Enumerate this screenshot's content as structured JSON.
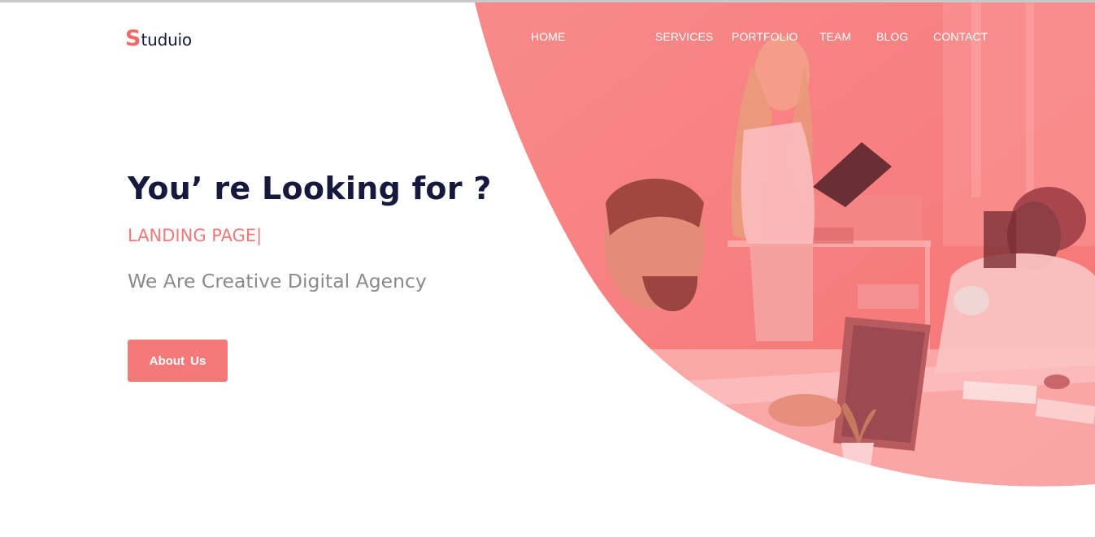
{
  "brand": {
    "logo_initial": "S",
    "logo_rest": "tuduio"
  },
  "nav": {
    "items": [
      {
        "label": "HOME"
      },
      {
        "label": "SERVICES"
      },
      {
        "label": "PORTFOLIO"
      },
      {
        "label": "TEAM"
      },
      {
        "label": "BLOG"
      },
      {
        "label": "CONTACT"
      }
    ]
  },
  "hero": {
    "headline": "You’ re Looking for ?",
    "typed_text": "LANDING PAGE",
    "typed_cursor": "|",
    "tagline": "We Are Creative Digital Agency",
    "cta_label": "About  Us",
    "image_icon": "office-team-photo"
  },
  "colors": {
    "accent": "#f47a7a",
    "overlay": "#f78080",
    "heading": "#16193b",
    "tagline": "#8a8a8a",
    "nav_text": "#ffffff"
  }
}
